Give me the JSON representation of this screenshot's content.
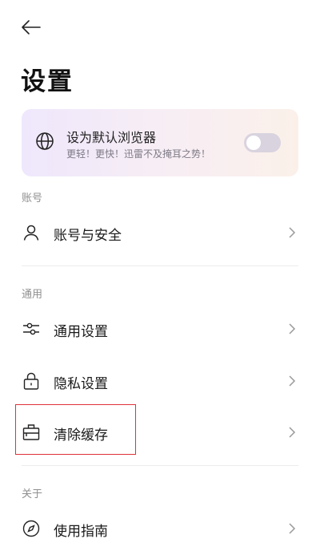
{
  "header": {
    "title": "设置"
  },
  "default_browser": {
    "title": "设为默认浏览器",
    "subtitle": "更轻！更快！迅雷不及掩耳之势！",
    "enabled": false
  },
  "sections": {
    "account": {
      "label": "账号",
      "items": [
        {
          "label": "账号与安全",
          "icon": "user-icon"
        }
      ]
    },
    "general": {
      "label": "通用",
      "items": [
        {
          "label": "通用设置",
          "icon": "sliders-icon"
        },
        {
          "label": "隐私设置",
          "icon": "lock-icon"
        },
        {
          "label": "清除缓存",
          "icon": "clear-cache-icon"
        }
      ]
    },
    "about": {
      "label": "关于",
      "items": [
        {
          "label": "使用指南",
          "icon": "compass-icon"
        }
      ]
    }
  },
  "colors": {
    "highlight": "#e0313b",
    "toggle_off": "#d9d3df"
  }
}
